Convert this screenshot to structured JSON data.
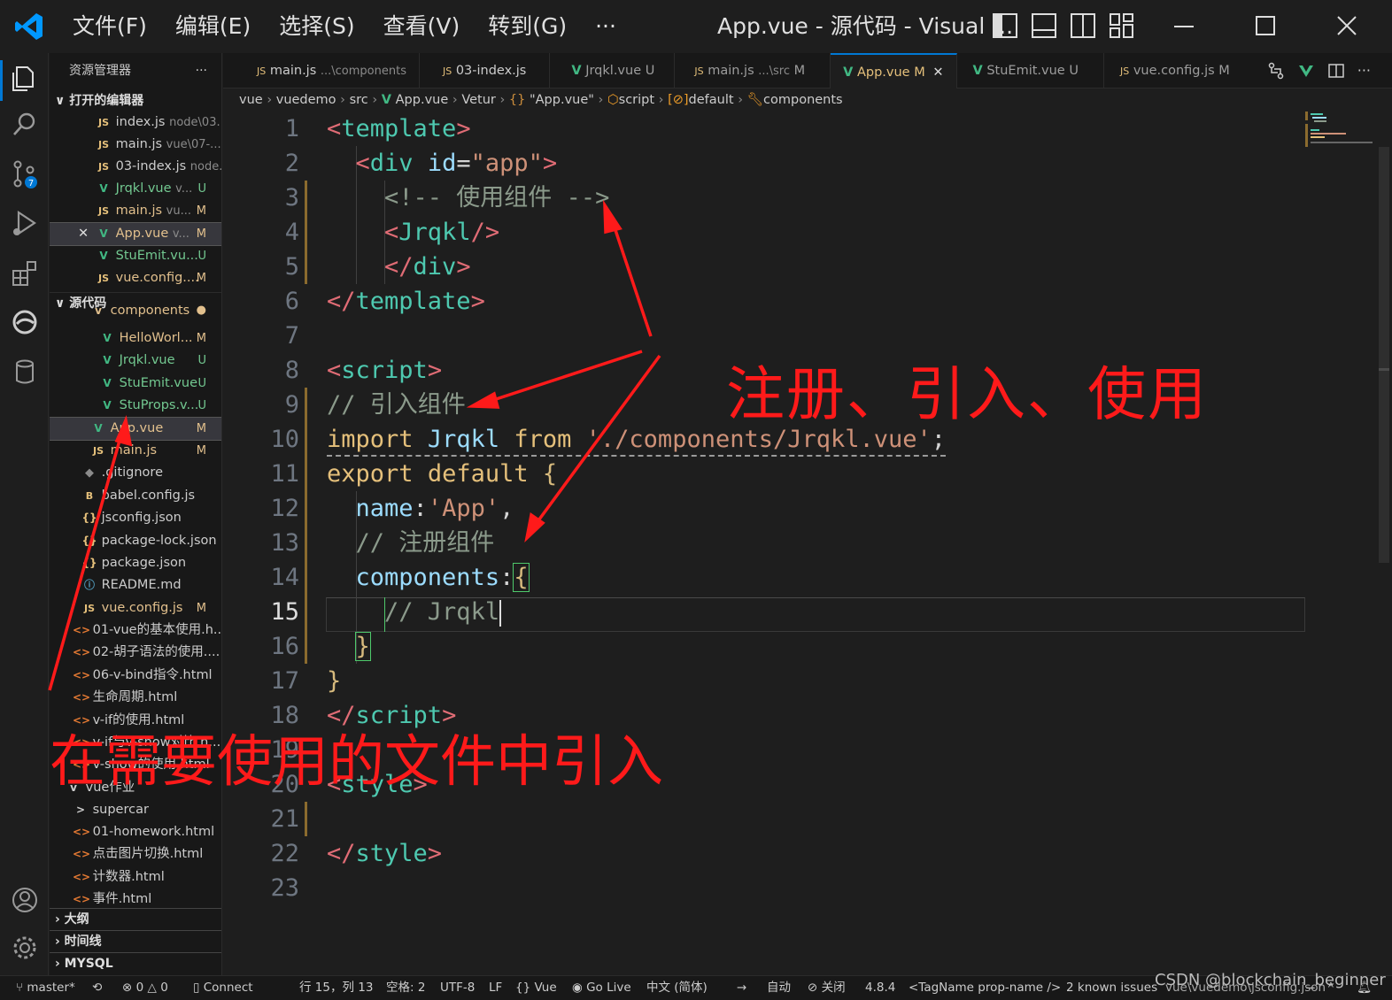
{
  "menu": [
    "文件(F)",
    "编辑(E)",
    "选择(S)",
    "查看(V)",
    "转到(G)",
    "···"
  ],
  "window_title": "App.vue - 源代码 - Visual ...",
  "sidebar": {
    "title": "资源管理器",
    "more": "···",
    "open_editors_label": "打开的编辑器",
    "open_editors": [
      {
        "icon": "JS",
        "name": "index.js",
        "desc": "node\\03...",
        "badge": ""
      },
      {
        "icon": "JS",
        "name": "main.js",
        "desc": "vue\\07-...",
        "badge": ""
      },
      {
        "icon": "JS",
        "name": "03-index.js",
        "desc": "node...",
        "badge": ""
      },
      {
        "icon": "V",
        "name": "Jrqkl.vue",
        "desc": "v...",
        "badge": "U"
      },
      {
        "icon": "JS",
        "name": "main.js",
        "desc": "vu...",
        "badge": "M"
      },
      {
        "icon": "V",
        "name": "App.vue",
        "desc": "v...",
        "badge": "M"
      },
      {
        "icon": "V",
        "name": "StuEmit.vu...",
        "desc": "",
        "badge": "U"
      },
      {
        "icon": "JS",
        "name": "vue.config....",
        "desc": "",
        "badge": "M"
      }
    ],
    "source_label": "源代码",
    "tree": [
      {
        "icon": "v",
        "name": "components",
        "badge": "●"
      },
      {
        "icon": "V",
        "name": "HelloWorl...",
        "badge": "M"
      },
      {
        "icon": "V",
        "name": "Jrqkl.vue",
        "badge": "U"
      },
      {
        "icon": "V",
        "name": "StuEmit.vue",
        "badge": "U"
      },
      {
        "icon": "V",
        "name": "StuProps.v...",
        "badge": "U"
      },
      {
        "icon": "V",
        "name": "App.vue",
        "badge": "M"
      },
      {
        "icon": "JS",
        "name": "main.js",
        "badge": "M"
      },
      {
        "icon": "◆",
        "name": ".gitignore",
        "badge": ""
      },
      {
        "icon": "B",
        "name": "babel.config.js",
        "badge": ""
      },
      {
        "icon": "{}",
        "name": "jsconfig.json",
        "badge": ""
      },
      {
        "icon": "{}",
        "name": "package-lock.json",
        "badge": ""
      },
      {
        "icon": "{}",
        "name": "package.json",
        "badge": ""
      },
      {
        "icon": "ⓘ",
        "name": "README.md",
        "badge": ""
      },
      {
        "icon": "JS",
        "name": "vue.config.js",
        "badge": "M"
      },
      {
        "icon": "<>",
        "name": "01-vue的基本使用.h...",
        "badge": ""
      },
      {
        "icon": "<>",
        "name": "02-胡子语法的使用....",
        "badge": ""
      },
      {
        "icon": "<>",
        "name": "06-v-bind指令.html",
        "badge": ""
      },
      {
        "icon": "<>",
        "name": "生命周期.html",
        "badge": ""
      },
      {
        "icon": "<>",
        "name": "v-if的使用.html",
        "badge": ""
      },
      {
        "icon": "<>",
        "name": "v-if与v-show对比.h...",
        "badge": ""
      },
      {
        "icon": "<>",
        "name": "v-show的使用.html",
        "badge": ""
      },
      {
        "icon": "v",
        "name": "vue作业",
        "badge": ""
      },
      {
        "icon": ">",
        "name": "supercar",
        "badge": ""
      },
      {
        "icon": "<>",
        "name": "01-homework.html",
        "badge": ""
      },
      {
        "icon": "<>",
        "name": "点击图片切换.html",
        "badge": ""
      },
      {
        "icon": "<>",
        "name": "计数器.html",
        "badge": ""
      },
      {
        "icon": "<>",
        "name": "事件.html",
        "badge": ""
      }
    ],
    "bottom_sections": [
      "大纲",
      "时间线",
      "MYSQL"
    ]
  },
  "tabs": [
    {
      "icon": "JS",
      "name": "main.js",
      "desc": "...\\components",
      "badge": ""
    },
    {
      "icon": "JS",
      "name": "03-index.js",
      "desc": "",
      "badge": ""
    },
    {
      "icon": "V",
      "name": "Jrqkl.vue",
      "desc": "",
      "badge": "U"
    },
    {
      "icon": "JS",
      "name": "main.js",
      "desc": "...\\src",
      "badge": "M"
    },
    {
      "icon": "V",
      "name": "App.vue",
      "desc": "",
      "badge": "M"
    },
    {
      "icon": "V",
      "name": "StuEmit.vue",
      "desc": "",
      "badge": "U"
    },
    {
      "icon": "JS",
      "name": "vue.config.js",
      "desc": "",
      "badge": "M"
    }
  ],
  "breadcrumbs": [
    "vue",
    "vuedemo",
    "src",
    "App.vue",
    "Vetur",
    "\"App.vue\"",
    "script",
    "default",
    "components"
  ],
  "code": {
    "line_numbers": [
      "1",
      "2",
      "3",
      "4",
      "5",
      "6",
      "7",
      "8",
      "9",
      "10",
      "11",
      "12",
      "13",
      "14",
      "15",
      "16",
      "17",
      "18",
      "19",
      "20",
      "21",
      "22",
      "23"
    ],
    "current_line": "15"
  },
  "annotations": {
    "big_right": "注册、引入、使用",
    "big_bottom": "在需要使用的文件中引入"
  },
  "status": {
    "branch": "master*",
    "errors": "0",
    "warnings": "0",
    "connect": "Connect",
    "position": "行 15，列 13",
    "spaces": "空格: 2",
    "encoding": "UTF-8",
    "eol": "LF",
    "language": "Vue",
    "golive": "Go Live",
    "locale": "中文 (简体)",
    "auto": "自动",
    "close": "关闭",
    "version": "4.8.4",
    "tagname": "<TagName prop-name />",
    "issues": "2 known issues",
    "config": "vue\\vuedemo\\jsconfig.json",
    "watermark": "CSDN @blockchain_beginner"
  },
  "colors": {
    "accent": "#0078d4",
    "annotation": "#ff1a1a",
    "tag": "#4ec9b0"
  }
}
